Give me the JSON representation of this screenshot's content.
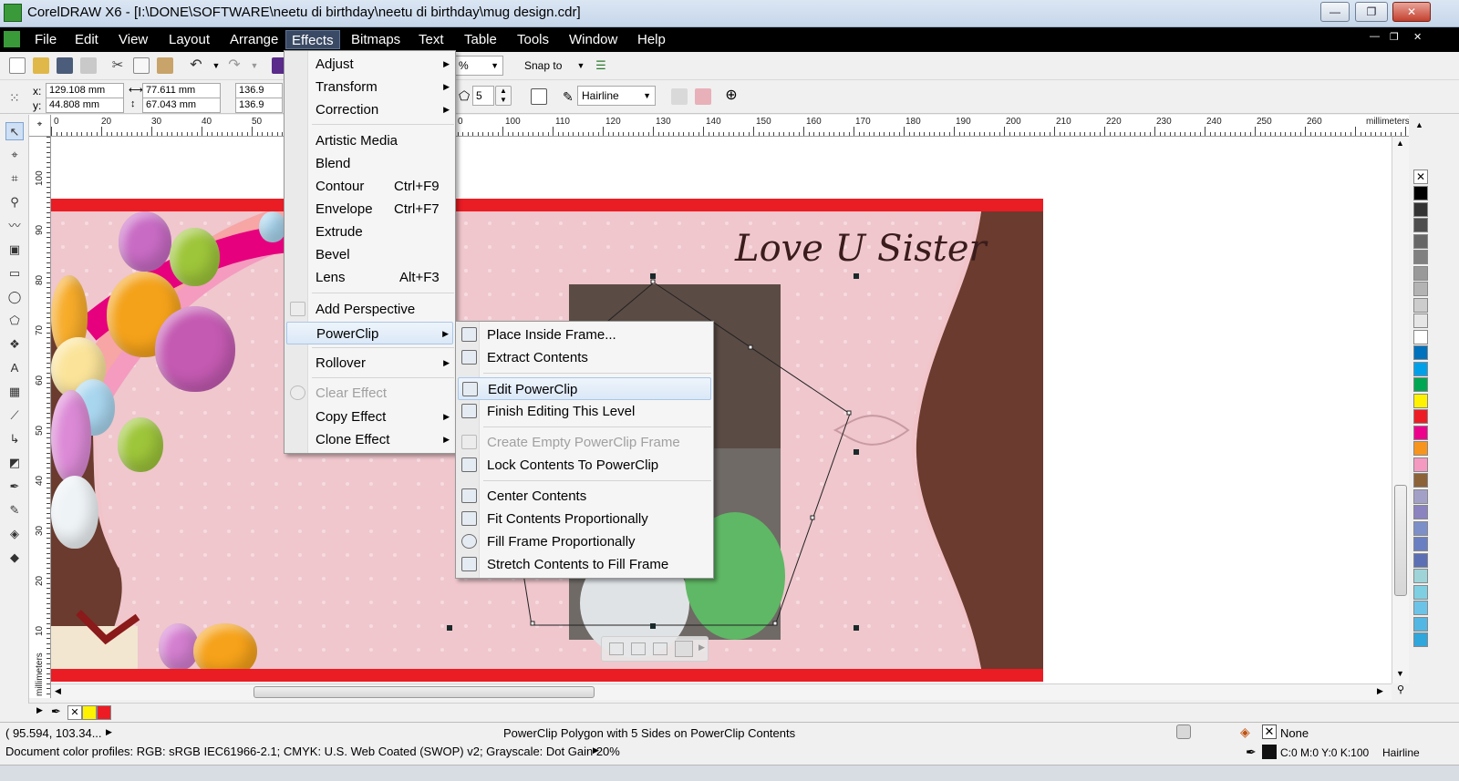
{
  "window": {
    "title": "CorelDRAW X6 - [I:\\DONE\\SOFTWARE\\neetu di birthday\\neetu di birthday\\mug design.cdr]",
    "buttons": {
      "minimize": "—",
      "restore": "❐",
      "close": "✕"
    }
  },
  "menubar": {
    "items": [
      "File",
      "Edit",
      "View",
      "Layout",
      "Arrange",
      "Effects",
      "Bitmaps",
      "Text",
      "Table",
      "Tools",
      "Window",
      "Help"
    ],
    "active": "Effects"
  },
  "toolbar": {
    "zoom_value": "%",
    "snap_to": "Snap to"
  },
  "propertybar": {
    "x_label": "x:",
    "x_value": "129.108 mm",
    "y_label": "y:",
    "y_value": "44.808 mm",
    "width_value": "77.611 mm",
    "height_value": "67.043 mm",
    "scale_x": "136.9",
    "scale_y": "136.9",
    "sides_value": "5",
    "outline": "Hairline"
  },
  "ruler": {
    "h_labels": [
      "0",
      "20",
      "30",
      "40",
      "50",
      "0",
      "100",
      "110",
      "120",
      "130",
      "140",
      "150",
      "160",
      "170",
      "180",
      "190",
      "200",
      "210",
      "220",
      "230",
      "240",
      "250",
      "260"
    ],
    "unit": "millimeters",
    "v_labels": [
      "100",
      "90",
      "80",
      "70",
      "60",
      "50",
      "40",
      "30",
      "20",
      "10"
    ]
  },
  "design": {
    "headline": "Love U Sister"
  },
  "effects_menu": {
    "items": [
      {
        "label": "Adjust",
        "submenu": true
      },
      {
        "label": "Transform",
        "submenu": true
      },
      {
        "label": "Correction",
        "submenu": true
      },
      {
        "label": "Artistic Media"
      },
      {
        "label": "Blend"
      },
      {
        "label": "Contour",
        "shortcut": "Ctrl+F9"
      },
      {
        "label": "Envelope",
        "shortcut": "Ctrl+F7"
      },
      {
        "label": "Extrude"
      },
      {
        "label": "Bevel"
      },
      {
        "label": "Lens",
        "shortcut": "Alt+F3"
      },
      {
        "label": "Add Perspective"
      },
      {
        "label": "PowerClip",
        "submenu": true,
        "highlighted": true
      },
      {
        "label": "Rollover",
        "submenu": true
      },
      {
        "label": "Clear Effect",
        "disabled": true
      },
      {
        "label": "Copy Effect",
        "submenu": true
      },
      {
        "label": "Clone Effect",
        "submenu": true
      }
    ]
  },
  "powerclip_menu": {
    "items": [
      {
        "label": "Place Inside Frame..."
      },
      {
        "label": "Extract Contents"
      },
      {
        "label": "Edit PowerClip",
        "highlighted": true
      },
      {
        "label": "Finish Editing This Level"
      },
      {
        "label": "Create Empty PowerClip Frame",
        "disabled": true
      },
      {
        "label": "Lock Contents To PowerClip"
      },
      {
        "label": "Center Contents"
      },
      {
        "label": "Fit Contents Proportionally"
      },
      {
        "label": "Fill Frame Proportionally"
      },
      {
        "label": "Stretch Contents to Fill Frame"
      }
    ]
  },
  "palette": {
    "colors": [
      "#000000",
      "#333333",
      "#4d4d4d",
      "#666666",
      "#808080",
      "#999999",
      "#b3b3b3",
      "#cccccc",
      "#e6e6e6",
      "#ffffff",
      "#0071bc",
      "#00a0e9",
      "#00a651",
      "#fff200",
      "#ed1c24",
      "#ec008c",
      "#f7941d",
      "#f49ac1",
      "#8c6239",
      "#a3a0c8",
      "#8b82c0",
      "#7d8fc9",
      "#6a7fc2",
      "#5b6fb5",
      "#9ed4d8",
      "#7fcfe3",
      "#6cc3e8",
      "#52b7e3",
      "#2fa6dc"
    ]
  },
  "docbar": {
    "swatches": [
      "#fff200",
      "#ed1c24"
    ]
  },
  "status": {
    "coords": "( 95.594, 103.34...",
    "object_info": "PowerClip Polygon with 5 Sides on PowerClip Contents",
    "profiles": "Document color profiles: RGB: sRGB IEC61966-2.1; CMYK: U.S. Web Coated (SWOP) v2; Grayscale: Dot Gain 20%",
    "fill_label": "None",
    "outline_color": "C:0 M:0 Y:0 K:100",
    "outline_width": "Hairline"
  }
}
